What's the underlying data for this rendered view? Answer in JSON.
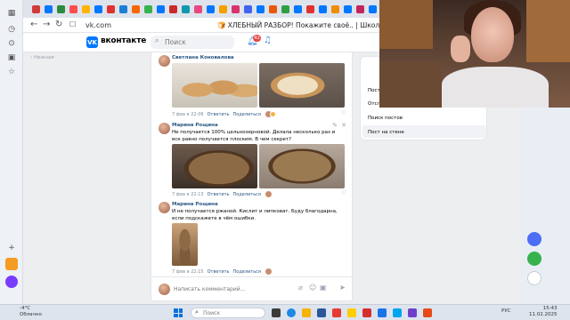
{
  "browser": {
    "url": "vk.com",
    "page_tab_title": "🍞 ХЛЕБНЫЙ РАЗБОР! Покажите своё.. | Школа хлеба Ольги Войновой"
  },
  "vk": {
    "wordmark": "вконтакте",
    "search_placeholder": "Поиск",
    "notifications_count": "42",
    "brand_color": "#0077ff"
  },
  "sidebar_hint": "Нежная",
  "comments": [
    {
      "author": "Светлана Коновалова",
      "text": "",
      "date": "7 фев в 22:06",
      "reply": "Ответить",
      "share": "Поделиться",
      "photos": [
        "bread-rolls",
        "bread-cut"
      ]
    },
    {
      "author": "Марина Рощина",
      "text": "Не получается 100% цельнозерновой. Делала несколько раз и все равно получается плоским. В чем секрет?",
      "date": "7 фев в 22:13",
      "reply": "Ответить",
      "share": "Поделиться",
      "photos": [
        "rye-slice",
        "rye-slice2"
      ]
    },
    {
      "author": "Марина Рощина",
      "text": "И не получается ржаной. Кислит и липковат. Буду благодарна, если подскажете в чём ошибки.",
      "date": "7 фев в 22:15",
      "reply": "Ответить",
      "share": "Поделиться",
      "photos": [
        "rye-small"
      ]
    }
  ],
  "comment_input_placeholder": "Написать комментарий...",
  "right_menu": {
    "items": [
      "Пост",
      "Отсл",
      "Поиск постов",
      "Пост на стене"
    ]
  },
  "taskbar": {
    "weather_temp": "-4°C",
    "weather_desc": "Облачно",
    "search_placeholder": "Поиск",
    "lang": "РУС",
    "time": "15:43",
    "date": "11.02.2025"
  }
}
